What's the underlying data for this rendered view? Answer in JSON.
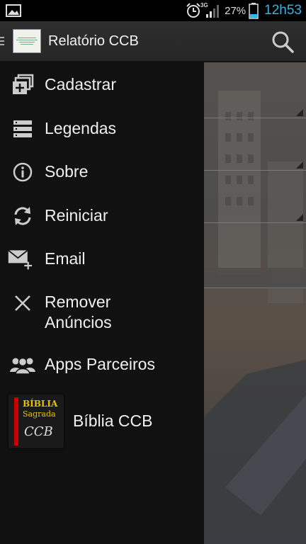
{
  "status_bar": {
    "network": "3G",
    "battery_percent": "27%",
    "time": "12h53",
    "icons": [
      "image-icon",
      "alarm-icon",
      "signal-icon",
      "battery-icon"
    ]
  },
  "action_bar": {
    "title": "Relatório CCB",
    "icons": [
      "drawer-indicator-icon",
      "app-logo-icon",
      "search-icon"
    ]
  },
  "drawer": {
    "items": [
      {
        "label": "Cadastrar",
        "icon": "add-stack-icon"
      },
      {
        "label": "Legendas",
        "icon": "list-icon"
      },
      {
        "label": "Sobre",
        "icon": "info-icon"
      },
      {
        "label": "Reiniciar",
        "icon": "refresh-icon"
      },
      {
        "label": "Email",
        "icon": "email-add-icon"
      },
      {
        "label": "Remover",
        "label2": "Anúncios",
        "icon": "close-icon"
      },
      {
        "label": "Apps Parceiros",
        "icon": "people-icon"
      }
    ],
    "promo": {
      "label": "Bíblia CCB",
      "thumb_line1": "BÍBLIA",
      "thumb_line2": "Sagrada",
      "thumb_line3": "CCB"
    }
  },
  "colors": {
    "clock": "#33b5e5",
    "drawer_bg": "#111111",
    "action_bar_bg": "#2a2a2a"
  }
}
